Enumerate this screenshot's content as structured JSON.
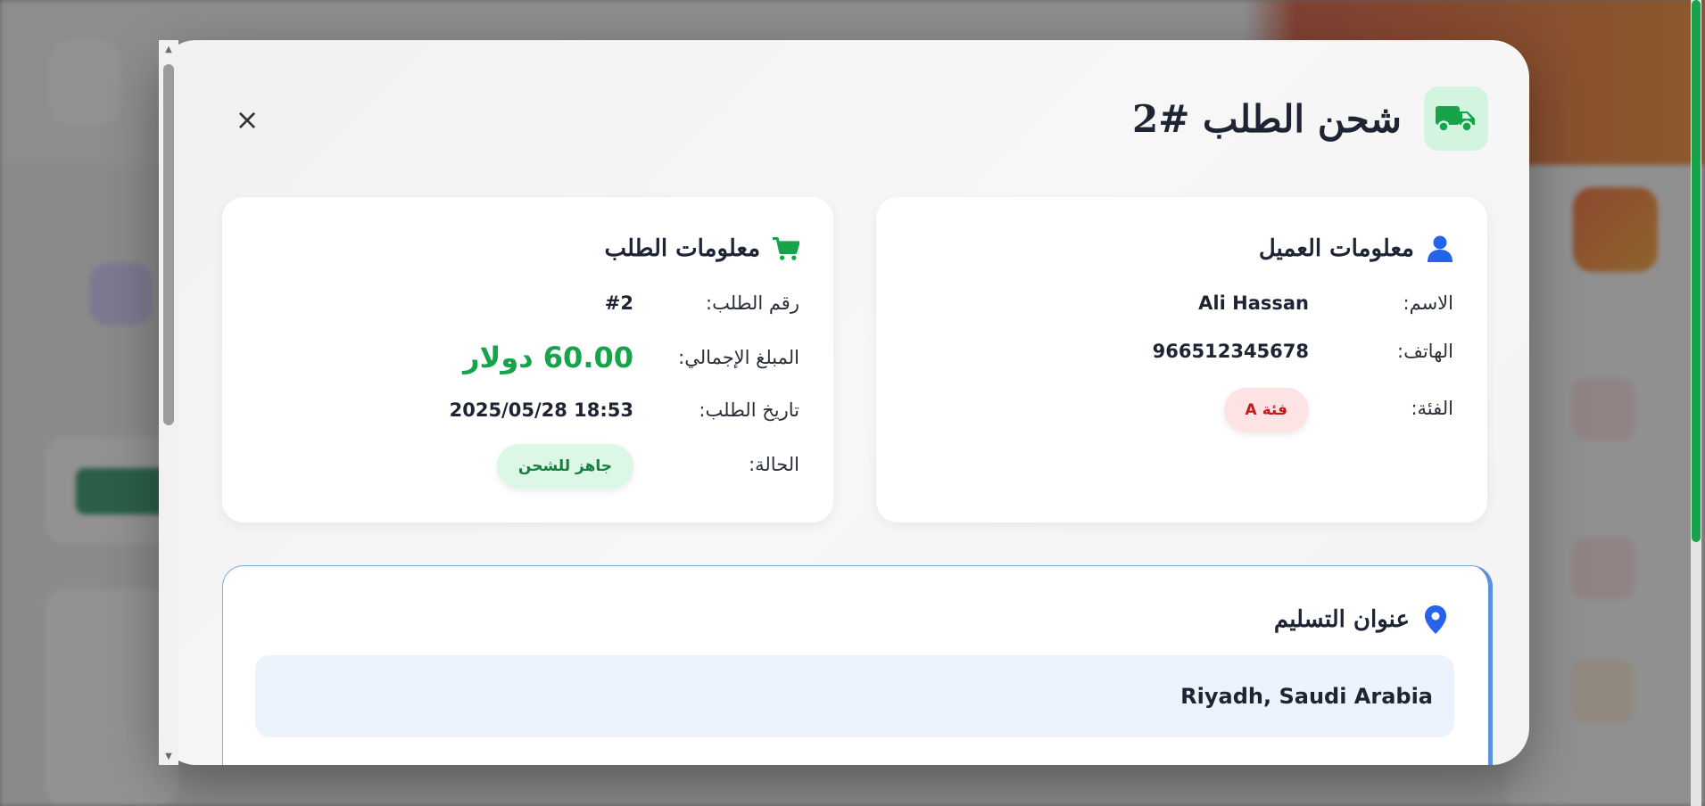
{
  "modal": {
    "title": "شحن الطلب #2",
    "title_icon": "truck-icon",
    "close_label": "×"
  },
  "customer_info": {
    "title": "معلومات العميل",
    "icon": "user-icon",
    "name_label": "الاسم:",
    "name_value": "Ali Hassan",
    "phone_label": "الهاتف:",
    "phone_value": "966512345678",
    "category_label": "الفئة:",
    "category_value": "فئة A"
  },
  "order_info": {
    "title": "معلومات الطلب",
    "icon": "cart-icon",
    "order_number_label": "رقم الطلب:",
    "order_number_value": "#2",
    "total_label": "المبلغ الإجمالي:",
    "total_value": "60.00 دولار",
    "date_label": "تاريخ الطلب:",
    "date_value": "2025/05/28 18:53",
    "status_label": "الحالة:",
    "status_value": "جاهز للشحن"
  },
  "delivery_address": {
    "title": "عنوان التسليم",
    "icon": "location-pin-icon",
    "address": "Riyadh, Saudi Arabia"
  },
  "colors": {
    "accent_green": "#16a34a",
    "accent_blue": "#2563eb",
    "category_badge_bg": "#fde3e3",
    "category_badge_text": "#c21d1d",
    "status_badge_bg": "#dcf7e6",
    "status_badge_text": "#15803d",
    "page_scroll_thumb": "#17a34a"
  }
}
